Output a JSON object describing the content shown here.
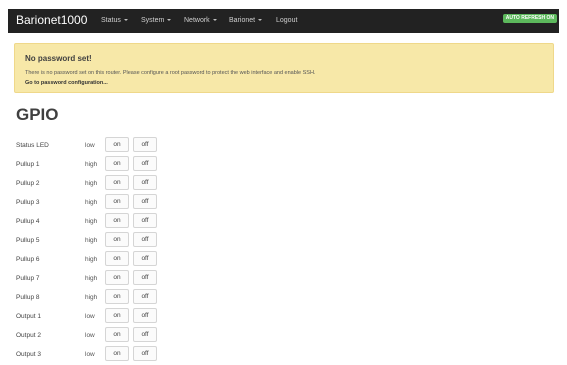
{
  "nav": {
    "brand": "Barionet1000",
    "items": [
      "Status",
      "System",
      "Network",
      "Barionet",
      "Logout"
    ],
    "auto_refresh": "AUTO REFRESH ON"
  },
  "alert": {
    "title": "No password set!",
    "text": "There is no password set on this router. Please configure a root password to protect the web interface and enable SSH.",
    "link": "Go to password configuration..."
  },
  "page": {
    "title": "GPIO"
  },
  "buttons": {
    "on": "on",
    "off": "off"
  },
  "rows": [
    {
      "label": "Status LED",
      "state": "low"
    },
    {
      "label": "Pullup 1",
      "state": "high"
    },
    {
      "label": "Pullup 2",
      "state": "high"
    },
    {
      "label": "Pullup 3",
      "state": "high"
    },
    {
      "label": "Pullup 4",
      "state": "high"
    },
    {
      "label": "Pullup 5",
      "state": "high"
    },
    {
      "label": "Pullup 6",
      "state": "high"
    },
    {
      "label": "Pullup 7",
      "state": "high"
    },
    {
      "label": "Pullup 8",
      "state": "high"
    },
    {
      "label": "Output 1",
      "state": "low"
    },
    {
      "label": "Output 2",
      "state": "low"
    },
    {
      "label": "Output 3",
      "state": "low"
    }
  ]
}
